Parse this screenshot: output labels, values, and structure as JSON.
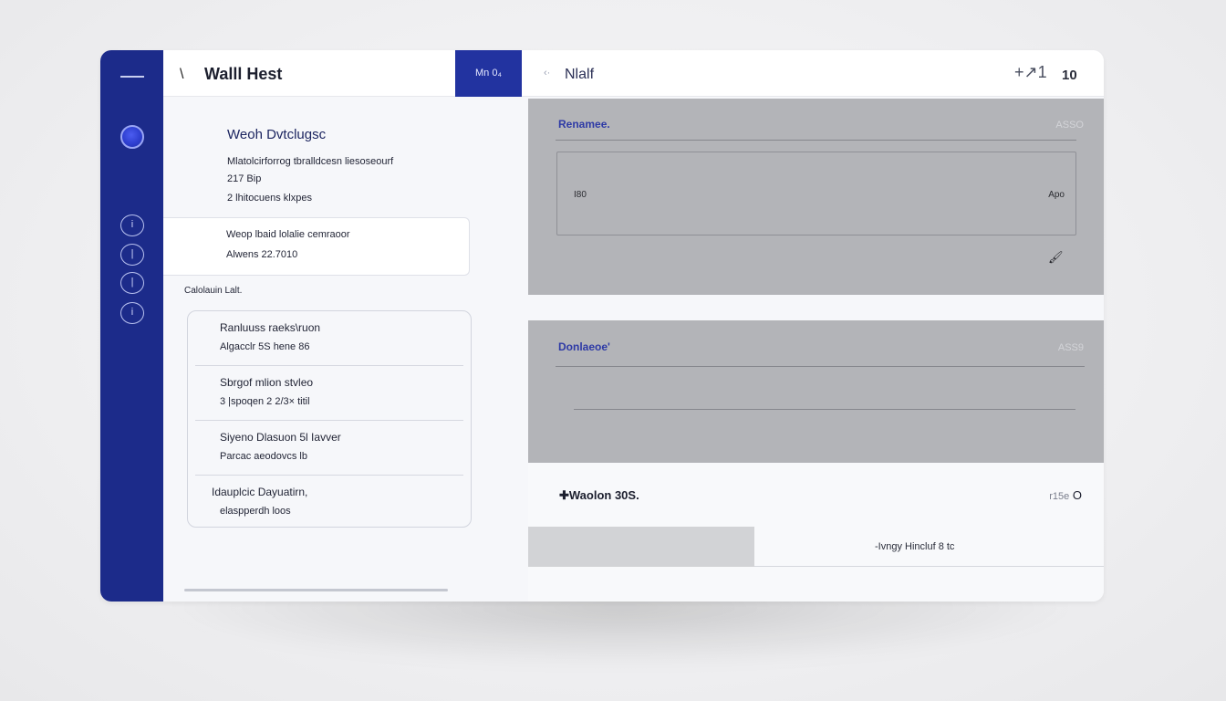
{
  "rail": {
    "buttons": [
      "i",
      "|",
      "|",
      "i"
    ]
  },
  "header": {
    "back_glyph": "\\",
    "app_title": "Walll Hest",
    "accent_label": "Mn 0₄",
    "right_chevron": "‹·",
    "right_title": "Nlalf",
    "add_label": "+↗1",
    "count": "10"
  },
  "left": {
    "title": "Weoh Dvtclugsc",
    "lines": [
      "Mlatolcirforrog tbralldcesn liesoseourf",
      "217  Bip",
      "2 lhitocuens klxpes"
    ],
    "card": {
      "line1": "Weop  lbaid lolalie cemraoor",
      "line2": "Alwens 22.7010"
    },
    "section_label": "Calolauin Lalt.",
    "list": [
      {
        "line1": "Ranluuss   raeks\\ruon",
        "line2": "Algacclr 5S hene 86"
      },
      {
        "line1": "Sbrgof mlion  stvleo",
        "line2": "3 |spoqen 2 2/3× titil"
      },
      {
        "line1": "Siyeno Dlasuon 5l Iavver",
        "line2": "Parcac aeodovcs lb"
      },
      {
        "line1": "Idauplcic Dayuatirn,",
        "line2": "elaspperdh loos"
      }
    ]
  },
  "panel1": {
    "label": "Renamee.",
    "aux": "ASSO",
    "field_left": "I80",
    "field_right": "Apo",
    "icon": "🖌"
  },
  "panel2": {
    "label": "Donlaeoe'",
    "aux": "ASS9"
  },
  "footer": {
    "label": "✚Waolon 30S.",
    "right_small": "r15e",
    "right_value": "O",
    "status": "-Ivngy Hincluf 8 tc"
  },
  "colors": {
    "rail": "#1c2b8a",
    "accent": "#2233a0",
    "panel": "#b3b4b8",
    "label_blue": "#2e3aa6"
  }
}
